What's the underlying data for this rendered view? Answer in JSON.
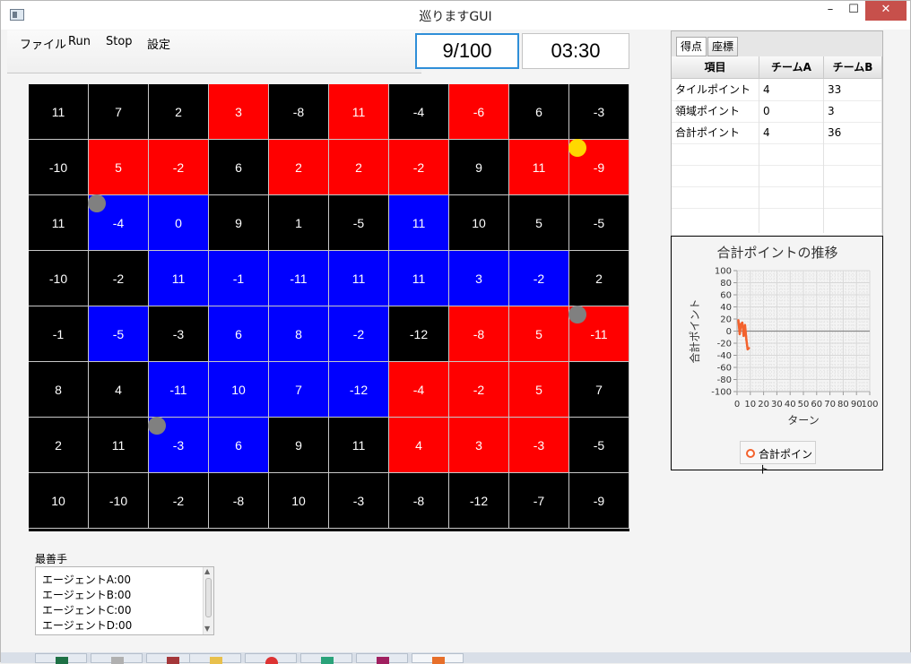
{
  "window": {
    "title": "巡りますGUI",
    "min_glyph": "–",
    "max_glyph": "☐",
    "close_glyph": "✕"
  },
  "menu": {
    "items": [
      "ファイル",
      "Run",
      "Stop",
      "設定"
    ]
  },
  "counters": {
    "turn": "9/100",
    "time": "03:30"
  },
  "board": {
    "cols": 10,
    "values": [
      [
        11,
        7,
        2,
        3,
        -8,
        11,
        -4,
        -6,
        6,
        -3
      ],
      [
        -10,
        5,
        -2,
        6,
        2,
        2,
        -2,
        9,
        11,
        -9
      ],
      [
        11,
        -4,
        0,
        9,
        1,
        -5,
        11,
        10,
        5,
        -5
      ],
      [
        -10,
        -2,
        11,
        -1,
        -11,
        11,
        11,
        3,
        -2,
        2
      ],
      [
        -1,
        -5,
        -3,
        6,
        8,
        -2,
        -12,
        -8,
        5,
        -11
      ],
      [
        8,
        4,
        -11,
        10,
        7,
        -12,
        -4,
        -2,
        5,
        7
      ],
      [
        2,
        11,
        -3,
        6,
        9,
        11,
        4,
        3,
        -3,
        -5
      ],
      [
        10,
        -10,
        -2,
        -8,
        10,
        -3,
        -8,
        -12,
        -7,
        -9
      ]
    ],
    "colors": [
      [
        "black",
        "black",
        "black",
        "red",
        "black",
        "red",
        "black",
        "red",
        "black",
        "black"
      ],
      [
        "black",
        "red",
        "red",
        "black",
        "red",
        "red",
        "red",
        "black",
        "red",
        "red"
      ],
      [
        "black",
        "blue",
        "blue",
        "black",
        "black",
        "black",
        "blue",
        "black",
        "black",
        "black"
      ],
      [
        "black",
        "black",
        "blue",
        "blue",
        "blue",
        "blue",
        "blue",
        "blue",
        "blue",
        "black"
      ],
      [
        "black",
        "blue",
        "black",
        "blue",
        "blue",
        "blue",
        "black",
        "red",
        "red",
        "red"
      ],
      [
        "black",
        "black",
        "blue",
        "blue",
        "blue",
        "blue",
        "red",
        "red",
        "red",
        "black"
      ],
      [
        "black",
        "black",
        "blue",
        "blue",
        "black",
        "black",
        "red",
        "red",
        "red",
        "black"
      ],
      [
        "black",
        "black",
        "black",
        "black",
        "black",
        "black",
        "black",
        "black",
        "black",
        "black"
      ]
    ],
    "palette": {
      "red": "#ff0000",
      "blue": "#0000ff",
      "black": "#000000"
    },
    "agents": [
      {
        "row": 1,
        "col": 9,
        "color": "yellow"
      },
      {
        "row": 2,
        "col": 1,
        "color": "gray"
      },
      {
        "row": 4,
        "col": 9,
        "color": "gray"
      },
      {
        "row": 6,
        "col": 2,
        "color": "gray"
      }
    ]
  },
  "best_moves": {
    "label": "最善手",
    "lines": [
      "エージェントA:00",
      "エージェントB:00",
      "エージェントC:00",
      "エージェントD:00"
    ]
  },
  "tabs": [
    {
      "label": "得点",
      "active": true
    },
    {
      "label": "座標",
      "active": false
    }
  ],
  "score_table": {
    "headers": [
      "項目",
      "チームA",
      "チームB"
    ],
    "rows": [
      [
        "タイルポイント",
        "4",
        "33"
      ],
      [
        "領域ポイント",
        "0",
        "3"
      ],
      [
        "合計ポイント",
        "4",
        "36"
      ]
    ]
  },
  "chart_data": {
    "type": "line",
    "title": "合計ポイントの推移",
    "xlabel": "ターン",
    "ylabel": "合計ポイント",
    "xlim": [
      0,
      100
    ],
    "ylim": [
      -100,
      100
    ],
    "xticks": [
      0,
      10,
      20,
      30,
      40,
      50,
      60,
      70,
      80,
      90,
      100
    ],
    "yticks": [
      100,
      80,
      60,
      40,
      20,
      0,
      -20,
      -40,
      -60,
      -80,
      -100
    ],
    "grid": true,
    "legend_position": "bottom",
    "series": [
      {
        "name": "合計ポイント",
        "color": "#f3622d",
        "points": [
          [
            1,
            18
          ],
          [
            2,
            -5
          ],
          [
            3,
            12
          ],
          [
            4,
            14
          ],
          [
            5,
            -8
          ],
          [
            6,
            10
          ],
          [
            7,
            -14
          ],
          [
            8,
            -30
          ],
          [
            9,
            -28
          ]
        ]
      }
    ]
  }
}
